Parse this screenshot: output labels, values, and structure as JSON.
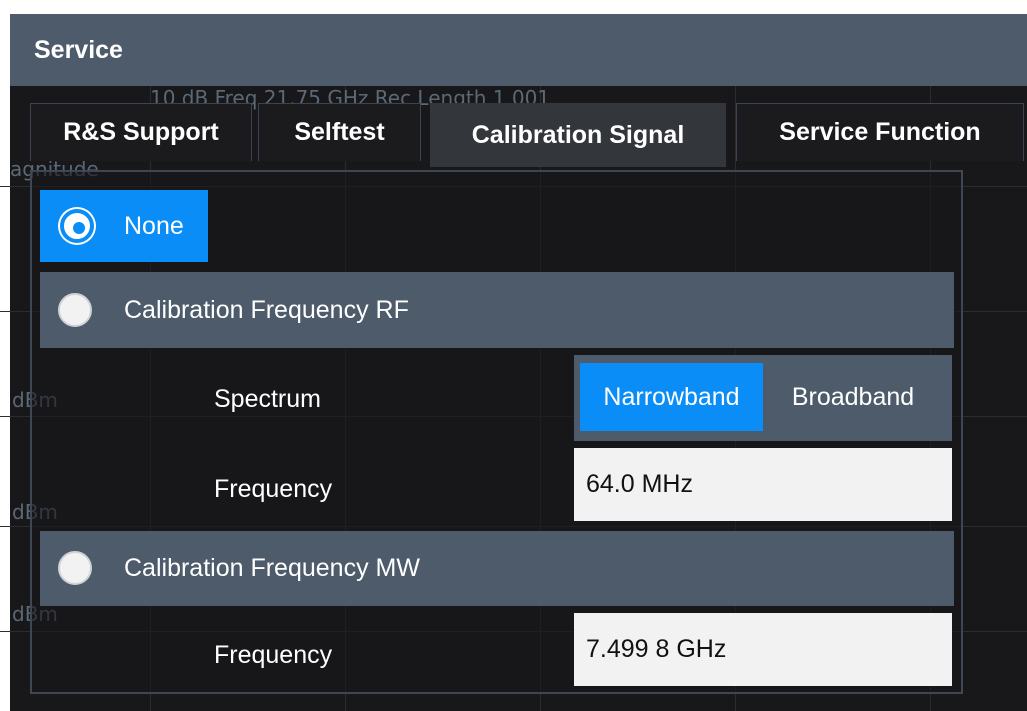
{
  "dialog": {
    "title": "Service"
  },
  "background": {
    "ghost_line1": "10 dB     Freq  21.75 GHz     Rec Length        1 001",
    "ghost_magnitude": "agnitude",
    "ghost_unit1": "dBm",
    "ghost_unit2": "dBm",
    "ghost_unit3": "dBm"
  },
  "tabs": [
    {
      "label": "R&S Support",
      "active": false
    },
    {
      "label": "Selftest",
      "active": false
    },
    {
      "label": "Calibration Signal",
      "active": true
    },
    {
      "label": "Service Function",
      "active": false
    }
  ],
  "calibration": {
    "none": {
      "label": "None",
      "selected": true
    },
    "rf": {
      "label": "Calibration Frequency RF",
      "selected": false,
      "spectrum_label": "Spectrum",
      "spectrum_options": [
        "Narrowband",
        "Broadband"
      ],
      "spectrum_selected": "Narrowband",
      "frequency_label": "Frequency",
      "frequency_value": "64.0 MHz"
    },
    "mw": {
      "label": "Calibration Frequency MW",
      "selected": false,
      "frequency_label": "Frequency",
      "frequency_value": "7.499 8 GHz"
    }
  },
  "colors": {
    "accent": "#0a8df7",
    "title_bar": "#4d5b6b",
    "background": "#18181a",
    "field": "#f2f2f2"
  }
}
